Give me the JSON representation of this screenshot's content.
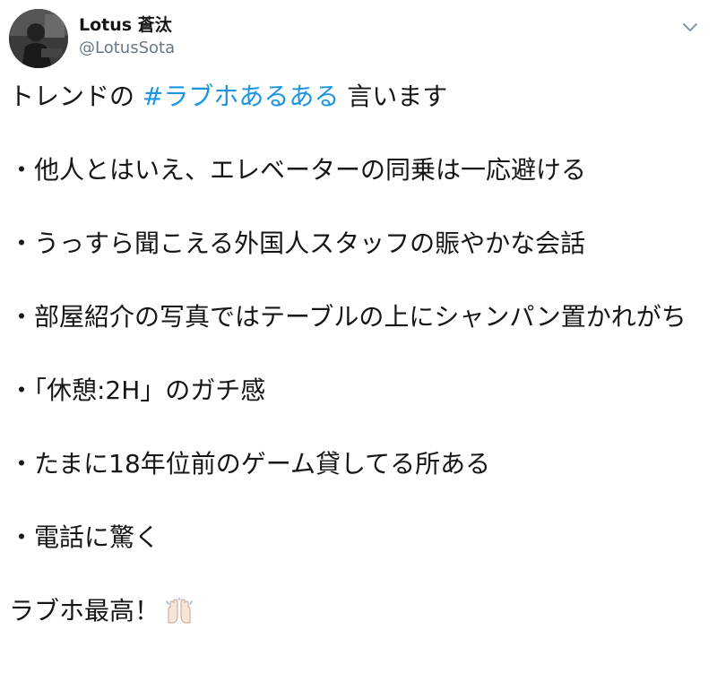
{
  "user": {
    "display_name": "Lotus 蒼汰",
    "handle": "@LotusSota",
    "avatar": "profile-photo"
  },
  "menu_icon": "chevron-down-icon",
  "tweet": {
    "intro_prefix": "トレンドの ",
    "hashtag": "#ラブホあるある",
    "intro_suffix": " 言います",
    "items": [
      "・他人とはいえ、エレベーターの同乗は一応避ける",
      "・うっすら聞こえる外国人スタッフの賑やかな会話",
      "・部屋紹介の写真ではテーブルの上にシャンパン置かれがち",
      "・「休憩:2H」のガチ感",
      "・たまに18年位前のゲーム貸してる所ある",
      "・電話に驚く"
    ],
    "closing": "ラブホ最高！",
    "closing_emoji": "raising-hands-emoji"
  }
}
